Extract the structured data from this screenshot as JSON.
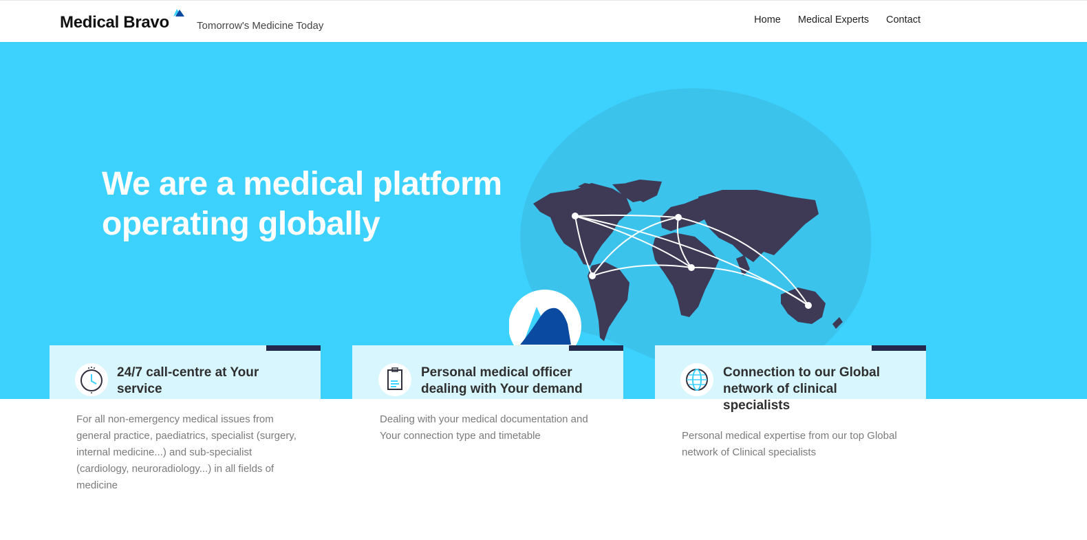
{
  "header": {
    "brand": "Medical Bravo",
    "tagline": "Tomorrow's Medicine Today",
    "nav": [
      "Home",
      "Medical Experts",
      "Contact"
    ]
  },
  "hero": {
    "title_line1": "We are a medical platform",
    "title_line2": "operating globally"
  },
  "features": [
    {
      "icon": "clock-icon",
      "title": "24/7 call-centre at Your service",
      "description": "For all non-emergency medical issues from general practice, paediatrics, specialist (surgery, internal medicine...) and sub-specialist (cardiology, neuroradiology...) in all fields of medicine"
    },
    {
      "icon": "clipboard-icon",
      "title": "Personal medical officer dealing with Your demand",
      "description": "Dealing with your medical documentation and Your connection type and timetable"
    },
    {
      "icon": "globe-icon",
      "title": "Connection to our Global network of clinical specialists",
      "description": "Personal medical expertise from our top Global network of Clinical specialists"
    }
  ],
  "colors": {
    "hero_bg": "#3dd2fe",
    "card_bg": "#d8f6fe",
    "accent_dark": "#24284a",
    "brand_blue": "#0a4aa0"
  }
}
